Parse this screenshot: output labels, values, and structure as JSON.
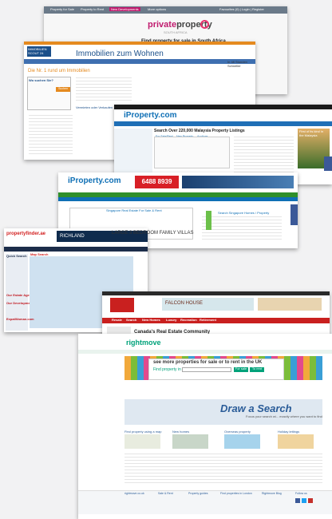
{
  "privateproperty": {
    "nav": [
      "Property for Sale",
      "Property to Rent",
      "New Developments",
      "More options"
    ],
    "login": "Favourites (0) | Login | Register",
    "logo_a": "private",
    "logo_b": "property",
    "logo_sub": "SOUTH AFRICA",
    "tagline": "Find property for sale in South Africa"
  },
  "immobilien": {
    "logo": "IMMOBILIEN SCOUT 24",
    "title": "Immobilien zum Wohnen",
    "headline": "Die Nr. 1 rund um Immobilien",
    "search_head": "Wo suchen Sie?",
    "button": "Suchen",
    "side_title": "Vermieten oder Verkaufen",
    "promo": "In 48 Stunden Schneller"
  },
  "iproperty_my": {
    "logo": "iProperty.com",
    "headline": "Search Over 220,000 Malaysia Property Listings",
    "tabs": [
      "For Sale/Rent",
      "New Property",
      "Auctions"
    ],
    "side_ad": "First of its kind in the Malaysia"
  },
  "iproperty_sg": {
    "logo": "iProperty.com",
    "banner": "6488 8939",
    "search_title": "Search Singapore Homes / Property",
    "panel_title": "Singapore Real Estate For Sale & Rent"
  },
  "propertyfinder": {
    "logo": "propertyfinder.ae",
    "richland": "RICHLAND",
    "ad_text": "LARGE 3 BEDROOM FAMILY VILLAS",
    "map_title": "Map Search",
    "side_sections": [
      "Quick Search",
      "Our Estate Agents",
      "Our Developments"
    ],
    "bottom_text": "ExpatWoman.com"
  },
  "canada": {
    "falcon": "FALCON HOUSE",
    "nav": [
      "Resale",
      "Search",
      "New Homes",
      "Luxury",
      "Recreation",
      "Retirement"
    ],
    "title": "Canada's Real Estate Community"
  },
  "rightmove": {
    "logo": "rightmove",
    "seemore": "see more properties for sale or to rent in the UK",
    "find": "Find property in",
    "btn_sale": "For sale",
    "btn_rent": "To rent",
    "draw": "Draw a Search",
    "draw_sub": "Focus your search wi... exactly where you want to find",
    "cols": [
      "Find property using a map",
      "New homes",
      "Overseas property",
      "Holiday lettings"
    ],
    "footer": [
      "rightmove.co.uk",
      "Sale & Rent",
      "Property guides",
      "Find properties in London",
      "Rightmove Blog",
      "Follow us"
    ]
  }
}
